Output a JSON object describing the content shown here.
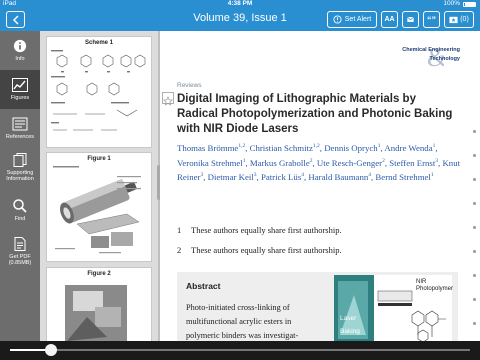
{
  "status_bar": {
    "carrier": "iPad",
    "time": "4:38 PM",
    "battery_text": "100%"
  },
  "nav": {
    "title": "Volume 39, Issue 1",
    "set_alert_label": "Set Alert",
    "font_size_label": "AA",
    "citation_label": "“”",
    "reading_list_count": "(0)"
  },
  "sidebar": {
    "items": [
      {
        "label": "Info"
      },
      {
        "label": "Figures"
      },
      {
        "label": "References"
      },
      {
        "label": "Supporting Information"
      },
      {
        "label": "Find"
      },
      {
        "label": "Get PDF (0.85MB)"
      }
    ]
  },
  "figures": [
    {
      "caption": "Scheme 1"
    },
    {
      "caption": "Figure 1"
    },
    {
      "caption": "Figure 2"
    }
  ],
  "article": {
    "journal_line1": "Chemical Engineering",
    "journal_line2": "Technology",
    "section": "Reviews",
    "title": "Digital Imaging of Lithographic Materials by Radical Photopolymerization and Photonic Baking with NIR Diode Lasers",
    "authors": [
      {
        "name": "Thomas Brömme",
        "sup": "1,2",
        "sep": ", "
      },
      {
        "name": "Christian Schmitz",
        "sup": "1,2",
        "sep": ", "
      },
      {
        "name": "Dennis Oprych",
        "sup": "1",
        "sep": ", "
      },
      {
        "name": "Andre Wenda",
        "sup": "1",
        "sep": ", "
      },
      {
        "name": "Veronika Strehmel",
        "sup": "1",
        "sep": ", "
      },
      {
        "name": "Markus Grabolle",
        "sup": "2",
        "sep": ", "
      },
      {
        "name": "Ute Resch-Genger",
        "sup": "2",
        "sep": ", "
      },
      {
        "name": "Steffen Ernst",
        "sup": "3",
        "sep": ", "
      },
      {
        "name": "Knut Reiner",
        "sup": "3",
        "sep": ", "
      },
      {
        "name": "Dietmar Keil",
        "sup": "3",
        "sep": ", "
      },
      {
        "name": "Patrick Lüs",
        "sup": "4",
        "sep": ", "
      },
      {
        "name": "Harald Baumann",
        "sup": "4",
        "sep": ", "
      },
      {
        "name": "Bernd Strehmel",
        "sup": "1",
        "sep": ""
      }
    ],
    "footnotes": [
      {
        "num": "1",
        "text": "These authors equally share first authorship."
      },
      {
        "num": "2",
        "text": "These authors equally share first authorship."
      }
    ],
    "abstract_heading": "Abstract",
    "abstract_text": "Photo-initiated cross-linking of multifunctional acrylic esters in polymeric binders was investigat-",
    "graphic": {
      "top_label": "NIR Photopolymer",
      "side_label1": "Laser",
      "side_label2": "Baking"
    }
  },
  "colors": {
    "accent": "#2a8fd0",
    "sidebar": "#6d6d6d",
    "author_link": "#2c5aa8"
  },
  "reader_progress": 0.09
}
